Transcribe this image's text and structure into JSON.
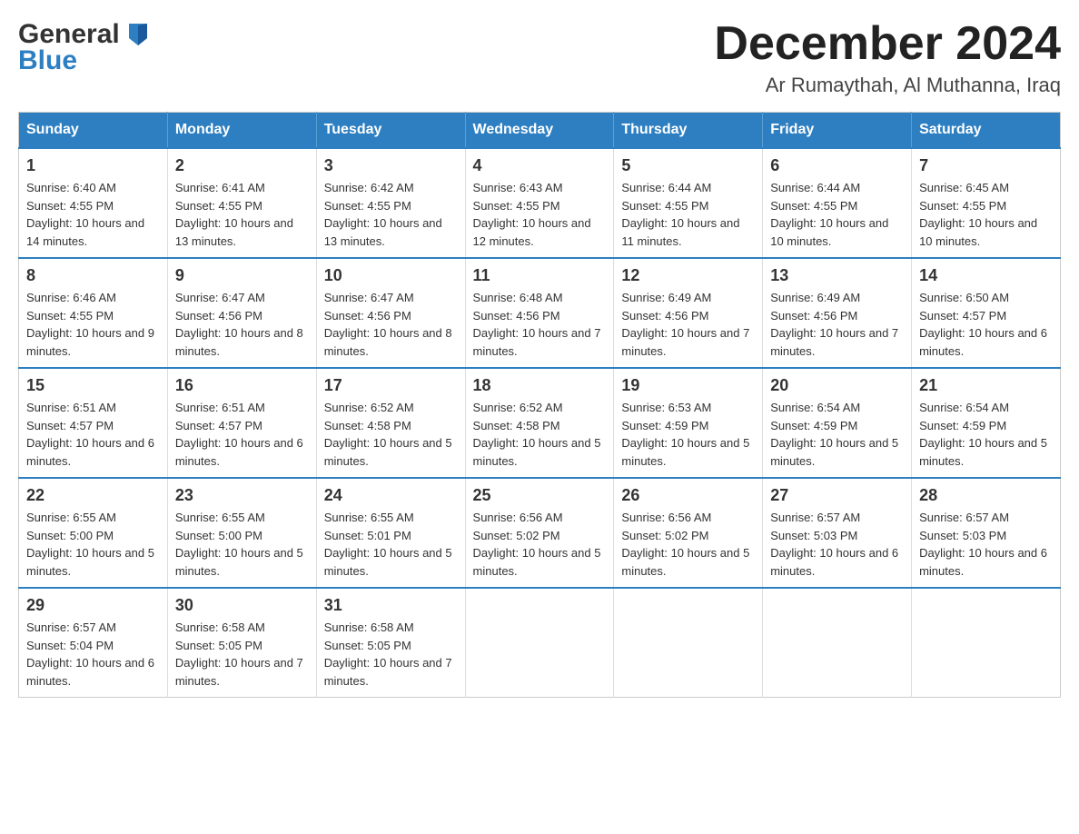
{
  "header": {
    "logo_line1": "General",
    "logo_line2": "Blue",
    "title": "December 2024",
    "subtitle": "Ar Rumaythah, Al Muthanna, Iraq"
  },
  "days_of_week": [
    "Sunday",
    "Monday",
    "Tuesday",
    "Wednesday",
    "Thursday",
    "Friday",
    "Saturday"
  ],
  "weeks": [
    [
      {
        "day": 1,
        "sunrise": "6:40 AM",
        "sunset": "4:55 PM",
        "daylight": "10 hours and 14 minutes."
      },
      {
        "day": 2,
        "sunrise": "6:41 AM",
        "sunset": "4:55 PM",
        "daylight": "10 hours and 13 minutes."
      },
      {
        "day": 3,
        "sunrise": "6:42 AM",
        "sunset": "4:55 PM",
        "daylight": "10 hours and 13 minutes."
      },
      {
        "day": 4,
        "sunrise": "6:43 AM",
        "sunset": "4:55 PM",
        "daylight": "10 hours and 12 minutes."
      },
      {
        "day": 5,
        "sunrise": "6:44 AM",
        "sunset": "4:55 PM",
        "daylight": "10 hours and 11 minutes."
      },
      {
        "day": 6,
        "sunrise": "6:44 AM",
        "sunset": "4:55 PM",
        "daylight": "10 hours and 10 minutes."
      },
      {
        "day": 7,
        "sunrise": "6:45 AM",
        "sunset": "4:55 PM",
        "daylight": "10 hours and 10 minutes."
      }
    ],
    [
      {
        "day": 8,
        "sunrise": "6:46 AM",
        "sunset": "4:55 PM",
        "daylight": "10 hours and 9 minutes."
      },
      {
        "day": 9,
        "sunrise": "6:47 AM",
        "sunset": "4:56 PM",
        "daylight": "10 hours and 8 minutes."
      },
      {
        "day": 10,
        "sunrise": "6:47 AM",
        "sunset": "4:56 PM",
        "daylight": "10 hours and 8 minutes."
      },
      {
        "day": 11,
        "sunrise": "6:48 AM",
        "sunset": "4:56 PM",
        "daylight": "10 hours and 7 minutes."
      },
      {
        "day": 12,
        "sunrise": "6:49 AM",
        "sunset": "4:56 PM",
        "daylight": "10 hours and 7 minutes."
      },
      {
        "day": 13,
        "sunrise": "6:49 AM",
        "sunset": "4:56 PM",
        "daylight": "10 hours and 7 minutes."
      },
      {
        "day": 14,
        "sunrise": "6:50 AM",
        "sunset": "4:57 PM",
        "daylight": "10 hours and 6 minutes."
      }
    ],
    [
      {
        "day": 15,
        "sunrise": "6:51 AM",
        "sunset": "4:57 PM",
        "daylight": "10 hours and 6 minutes."
      },
      {
        "day": 16,
        "sunrise": "6:51 AM",
        "sunset": "4:57 PM",
        "daylight": "10 hours and 6 minutes."
      },
      {
        "day": 17,
        "sunrise": "6:52 AM",
        "sunset": "4:58 PM",
        "daylight": "10 hours and 5 minutes."
      },
      {
        "day": 18,
        "sunrise": "6:52 AM",
        "sunset": "4:58 PM",
        "daylight": "10 hours and 5 minutes."
      },
      {
        "day": 19,
        "sunrise": "6:53 AM",
        "sunset": "4:59 PM",
        "daylight": "10 hours and 5 minutes."
      },
      {
        "day": 20,
        "sunrise": "6:54 AM",
        "sunset": "4:59 PM",
        "daylight": "10 hours and 5 minutes."
      },
      {
        "day": 21,
        "sunrise": "6:54 AM",
        "sunset": "4:59 PM",
        "daylight": "10 hours and 5 minutes."
      }
    ],
    [
      {
        "day": 22,
        "sunrise": "6:55 AM",
        "sunset": "5:00 PM",
        "daylight": "10 hours and 5 minutes."
      },
      {
        "day": 23,
        "sunrise": "6:55 AM",
        "sunset": "5:00 PM",
        "daylight": "10 hours and 5 minutes."
      },
      {
        "day": 24,
        "sunrise": "6:55 AM",
        "sunset": "5:01 PM",
        "daylight": "10 hours and 5 minutes."
      },
      {
        "day": 25,
        "sunrise": "6:56 AM",
        "sunset": "5:02 PM",
        "daylight": "10 hours and 5 minutes."
      },
      {
        "day": 26,
        "sunrise": "6:56 AM",
        "sunset": "5:02 PM",
        "daylight": "10 hours and 5 minutes."
      },
      {
        "day": 27,
        "sunrise": "6:57 AM",
        "sunset": "5:03 PM",
        "daylight": "10 hours and 6 minutes."
      },
      {
        "day": 28,
        "sunrise": "6:57 AM",
        "sunset": "5:03 PM",
        "daylight": "10 hours and 6 minutes."
      }
    ],
    [
      {
        "day": 29,
        "sunrise": "6:57 AM",
        "sunset": "5:04 PM",
        "daylight": "10 hours and 6 minutes."
      },
      {
        "day": 30,
        "sunrise": "6:58 AM",
        "sunset": "5:05 PM",
        "daylight": "10 hours and 7 minutes."
      },
      {
        "day": 31,
        "sunrise": "6:58 AM",
        "sunset": "5:05 PM",
        "daylight": "10 hours and 7 minutes."
      },
      null,
      null,
      null,
      null
    ]
  ],
  "labels": {
    "sunrise": "Sunrise:",
    "sunset": "Sunset:",
    "daylight": "Daylight:"
  }
}
